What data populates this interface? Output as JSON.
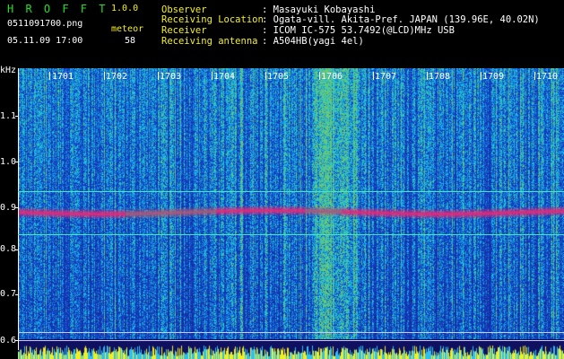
{
  "header": {
    "app_title": "H R O F F T",
    "version": "1.0.0",
    "filename": "0511091700.png",
    "datetime": "05.11.09 17:00",
    "meteor_label": "meteor",
    "meteor_count": "58"
  },
  "info": {
    "labels": [
      "Observer",
      "Receiving Location",
      "Receiver",
      "Receiving antenna"
    ],
    "values": [
      ": Masayuki Kobayashi",
      ": Ogata-vill. Akita-Pref. JAPAN (139.96E, 40.02N)",
      ": ICOM IC-575 53.7492(@LCD)MHz USB",
      ": A504HB(yagi 4el)"
    ]
  },
  "axes": {
    "y_unit": "kHz",
    "y_ticks": [
      "1.1",
      "1.0",
      "0.9",
      "0.8",
      "0.7",
      "0.6"
    ],
    "x_ticks": [
      "1701",
      "1702",
      "1703",
      "1704",
      "1705",
      "1706",
      "1707",
      "1708",
      "1709",
      "1710"
    ]
  },
  "colors": {
    "text_yellow": "#f4f020",
    "text_green": "#20e020",
    "background": "#000000",
    "spectrum_low": "#1a1a8c",
    "spectrum_high": "#e8287a",
    "guide_line": "#40e8c8"
  }
}
